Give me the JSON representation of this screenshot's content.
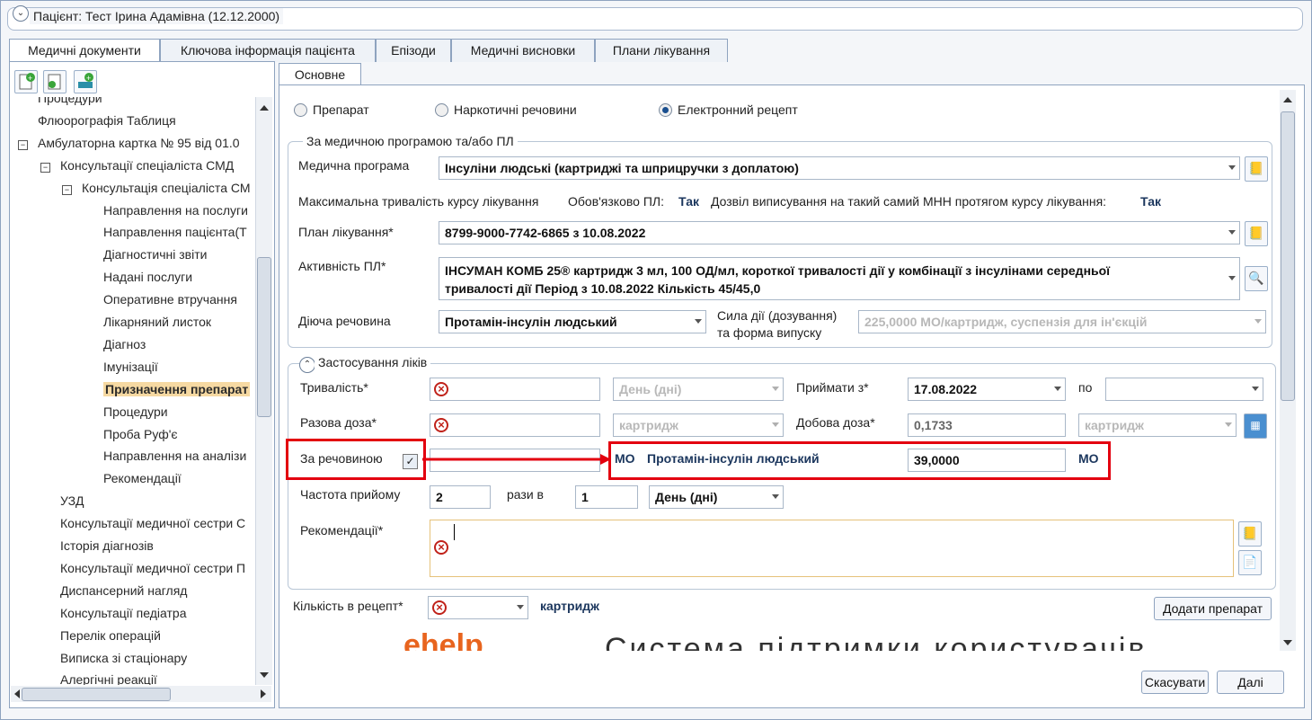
{
  "patient": {
    "label": "Пацієнт: Тест Ірина Адамівна (12.12.2000)"
  },
  "tabs": [
    "Медичні документи",
    "Ключова інформація пацієнта",
    "Епізоди",
    "Медичні висновки",
    "Плани лікування"
  ],
  "subtab": "Основне",
  "tree": [
    {
      "label": "Процедури",
      "indent": 0
    },
    {
      "label": "Флюорографія Таблиця",
      "indent": 0
    },
    {
      "label": "Амбулаторна картка № 95 від 01.0",
      "indent": 0,
      "toggle": "−"
    },
    {
      "label": "Консультації спеціаліста СМД",
      "indent": 1,
      "toggle": "−"
    },
    {
      "label": "Консультація спеціаліста СМ",
      "indent": 2,
      "toggle": "−"
    },
    {
      "label": "Направлення на послуги",
      "indent": 3
    },
    {
      "label": "Направлення пацієнта(Т",
      "indent": 3
    },
    {
      "label": "Діагностичні звіти",
      "indent": 3
    },
    {
      "label": "Надані послуги",
      "indent": 3
    },
    {
      "label": "Оперативне втручання",
      "indent": 3
    },
    {
      "label": "Лікарняний листок",
      "indent": 3
    },
    {
      "label": "Діагноз",
      "indent": 3
    },
    {
      "label": "Імунізації",
      "indent": 3
    },
    {
      "label": "Призначення препарат",
      "indent": 3,
      "selected": true
    },
    {
      "label": "Процедури",
      "indent": 3
    },
    {
      "label": "Проба Руф'є",
      "indent": 3
    },
    {
      "label": "Направлення на аналізи",
      "indent": 3
    },
    {
      "label": "Рекомендації",
      "indent": 3
    },
    {
      "label": "УЗД",
      "indent": 1
    },
    {
      "label": "Консультації медичної сестри С",
      "indent": 1
    },
    {
      "label": "Історія діагнозів",
      "indent": 1
    },
    {
      "label": "Консультації медичної сестри П",
      "indent": 1
    },
    {
      "label": "Диспансерний нагляд",
      "indent": 1
    },
    {
      "label": "Консультації педіатра",
      "indent": 1
    },
    {
      "label": "Перелік операцій",
      "indent": 1
    },
    {
      "label": "Виписка зі стаціонару",
      "indent": 1
    },
    {
      "label": "Алергічні реакції",
      "indent": 1
    }
  ],
  "radios": [
    "Препарат",
    "Наркотичні речовини",
    "Електронний рецепт"
  ],
  "program": {
    "title": "За медичною програмою та/або ПЛ",
    "med_program_label": "Медична програма",
    "med_program_value": "Інсуліни людські (картриджі та шприцручки з доплатою)",
    "max_duration": "Максимальна тривалість курсу лікування",
    "mandatory_label": "Обов'язково ПЛ:",
    "mandatory_value": "Так",
    "allow_label": "Дозвіл виписування на такий самий МНН протягом курсу лікування:",
    "allow_value": "Так",
    "plan_label": "План лікування*",
    "plan_value": "8799-9000-7742-6865 з 10.08.2022",
    "activity_label": "Активність ПЛ*",
    "activity_line1": "ІНСУМАН КОМБ 25® картридж 3 мл, 100 ОД/мл, короткої тривалості дії у комбінації з інсулінами середньої",
    "activity_line2": "тривалості дії Період з 10.08.2022 Кількість 45/45,0",
    "substance_label": "Діюча речовина",
    "substance_value": "Протамін-інсулін людський",
    "strength_label1": "Сила дії (дозування)",
    "strength_label2": "та форма випуску",
    "strength_value": "225,0000 МО/картридж, суспензія для ін'єкцій"
  },
  "usage": {
    "title": "Застосування ліків",
    "duration_label": "Тривалість*",
    "duration_unit": "День (дні)",
    "take_from_label": "Приймати з*",
    "take_from_value": "17.08.2022",
    "to_label": "по",
    "single_dose_label": "Разова доза*",
    "single_dose_unit": "картридж",
    "daily_dose_label": "Добова доза*",
    "daily_dose_value": "0,1733",
    "daily_dose_unit": "картридж",
    "by_substance_label": "За речовиною",
    "mo1": "МО",
    "substance_name": "Протамін-інсулін людський",
    "substance_amount": "39,0000",
    "mo2": "МО",
    "frequency_label": "Частота прийому",
    "frequency_value": "2",
    "times_in": "рази в",
    "period_value": "1",
    "period_unit": "День (дні)",
    "recommendations_label": "Рекомендації*"
  },
  "quantity": {
    "label": "Кількість в рецепт*",
    "unit": "картридж"
  },
  "buttons": {
    "add": "Додати препарат",
    "cancel": "Скасувати",
    "next": "Далі"
  },
  "banner": {
    "logo": "ehelp",
    "text": "Система підтримки користувачів"
  },
  "colors": {
    "highlight_red": "#e3000f",
    "selected_bg": "#f6d9a2",
    "label_blue": "#1b365d"
  }
}
